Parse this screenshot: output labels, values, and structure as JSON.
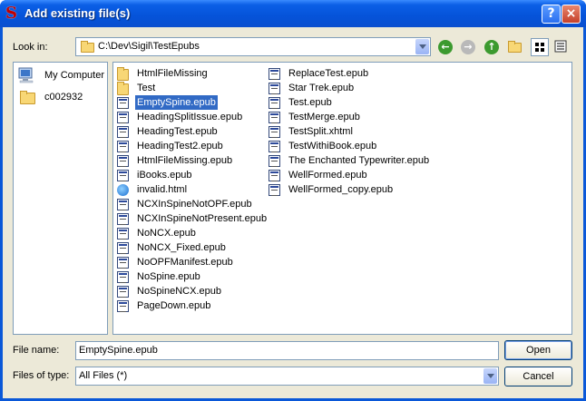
{
  "window": {
    "title": "Add existing file(s)",
    "help_label": "?",
    "close_label": "×",
    "app_icon_letter": "S"
  },
  "look_in": {
    "label": "Look in:",
    "path": "C:\\Dev\\Sigil\\TestEpubs"
  },
  "toolbar": {
    "icons": [
      "back-icon",
      "forward-icon",
      "up-icon",
      "new-folder-icon",
      "list-view-icon",
      "detail-view-icon"
    ]
  },
  "sidebar": {
    "items": [
      {
        "label": "My Computer",
        "icon": "computer-icon"
      },
      {
        "label": "c002932",
        "icon": "folder-icon"
      }
    ]
  },
  "files": {
    "column1": [
      {
        "name": "HtmlFileMissing",
        "type": "folder"
      },
      {
        "name": "Test",
        "type": "folder"
      },
      {
        "name": "EmptySpine.epub",
        "type": "epub",
        "selected": true
      },
      {
        "name": "HeadingSplitIssue.epub",
        "type": "epub"
      },
      {
        "name": "HeadingTest.epub",
        "type": "epub"
      },
      {
        "name": "HeadingTest2.epub",
        "type": "epub"
      },
      {
        "name": "HtmlFileMissing.epub",
        "type": "epub"
      },
      {
        "name": "iBooks.epub",
        "type": "epub"
      },
      {
        "name": "invalid.html",
        "type": "html"
      },
      {
        "name": "NCXInSpineNotOPF.epub",
        "type": "epub"
      },
      {
        "name": "NCXInSpineNotPresent.epub",
        "type": "epub"
      },
      {
        "name": "NoNCX.epub",
        "type": "epub"
      },
      {
        "name": "NoNCX_Fixed.epub",
        "type": "epub"
      },
      {
        "name": "NoOPFManifest.epub",
        "type": "epub"
      },
      {
        "name": "NoSpine.epub",
        "type": "epub"
      },
      {
        "name": "NoSpineNCX.epub",
        "type": "epub"
      },
      {
        "name": "PageDown.epub",
        "type": "epub"
      }
    ],
    "column2": [
      {
        "name": "ReplaceTest.epub",
        "type": "epub"
      },
      {
        "name": "Star Trek.epub",
        "type": "epub"
      },
      {
        "name": "Test.epub",
        "type": "epub"
      },
      {
        "name": "TestMerge.epub",
        "type": "epub"
      },
      {
        "name": "TestSplit.xhtml",
        "type": "epub"
      },
      {
        "name": "TestWithiBook.epub",
        "type": "epub"
      },
      {
        "name": "The Enchanted Typewriter.epub",
        "type": "epub"
      },
      {
        "name": "WellFormed.epub",
        "type": "epub"
      },
      {
        "name": "WellFormed_copy.epub",
        "type": "epub"
      }
    ]
  },
  "file_name": {
    "label": "File name:",
    "value": "EmptySpine.epub"
  },
  "file_type": {
    "label": "Files of type:",
    "value": "All Files (*)"
  },
  "buttons": {
    "open": "Open",
    "cancel": "Cancel"
  },
  "colors": {
    "titlebar": "#0553d9",
    "dialog_bg": "#ece9d8",
    "selection": "#316ac5"
  }
}
